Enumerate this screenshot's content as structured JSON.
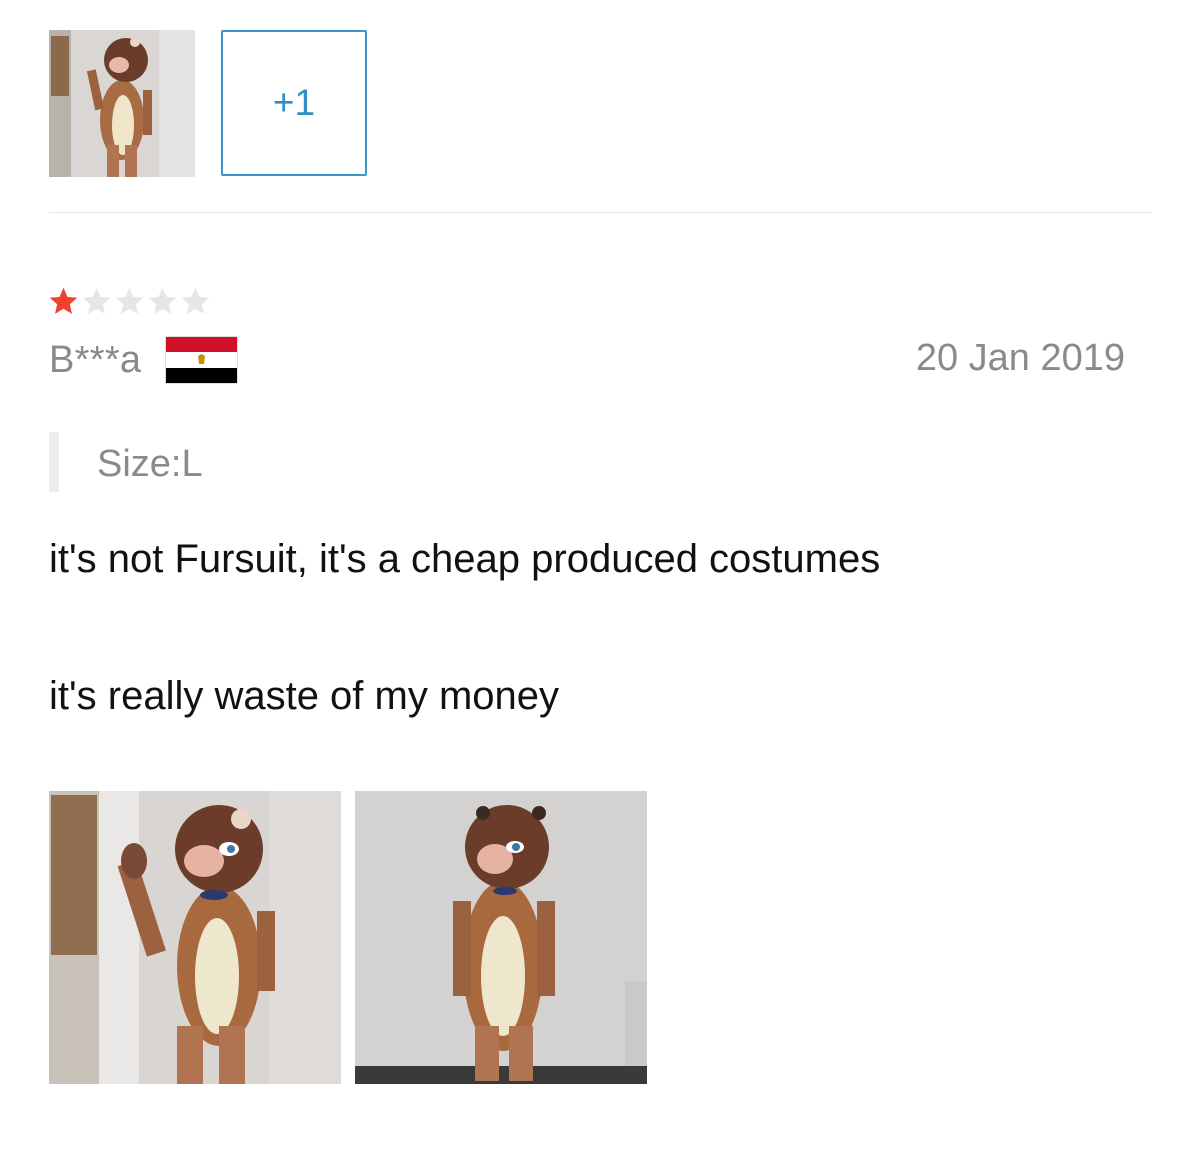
{
  "gallery": {
    "thumbnails": [
      {
        "alt": "lion-costume-photo"
      }
    ],
    "more_label": "+1"
  },
  "review": {
    "rating": 1,
    "rating_max": 5,
    "star_color_filled": "#f0422e",
    "star_color_empty": "#e6e6e6",
    "reviewer": "B***a",
    "country_flag_icon": "egypt-flag-icon",
    "date": "20 Jan 2019",
    "size_label": "Size:L",
    "text_lines": [
      "it's not Fursuit, it's a cheap produced costumes",
      "it's really waste of my money"
    ],
    "photos": [
      {
        "alt": "lion-costume-photo-side"
      },
      {
        "alt": "lion-costume-photo-front"
      }
    ]
  },
  "colors": {
    "accent": "#3a98c4",
    "muted_text": "#8a8a8a",
    "body_text": "#111111",
    "divider": "#e8e8e8"
  }
}
